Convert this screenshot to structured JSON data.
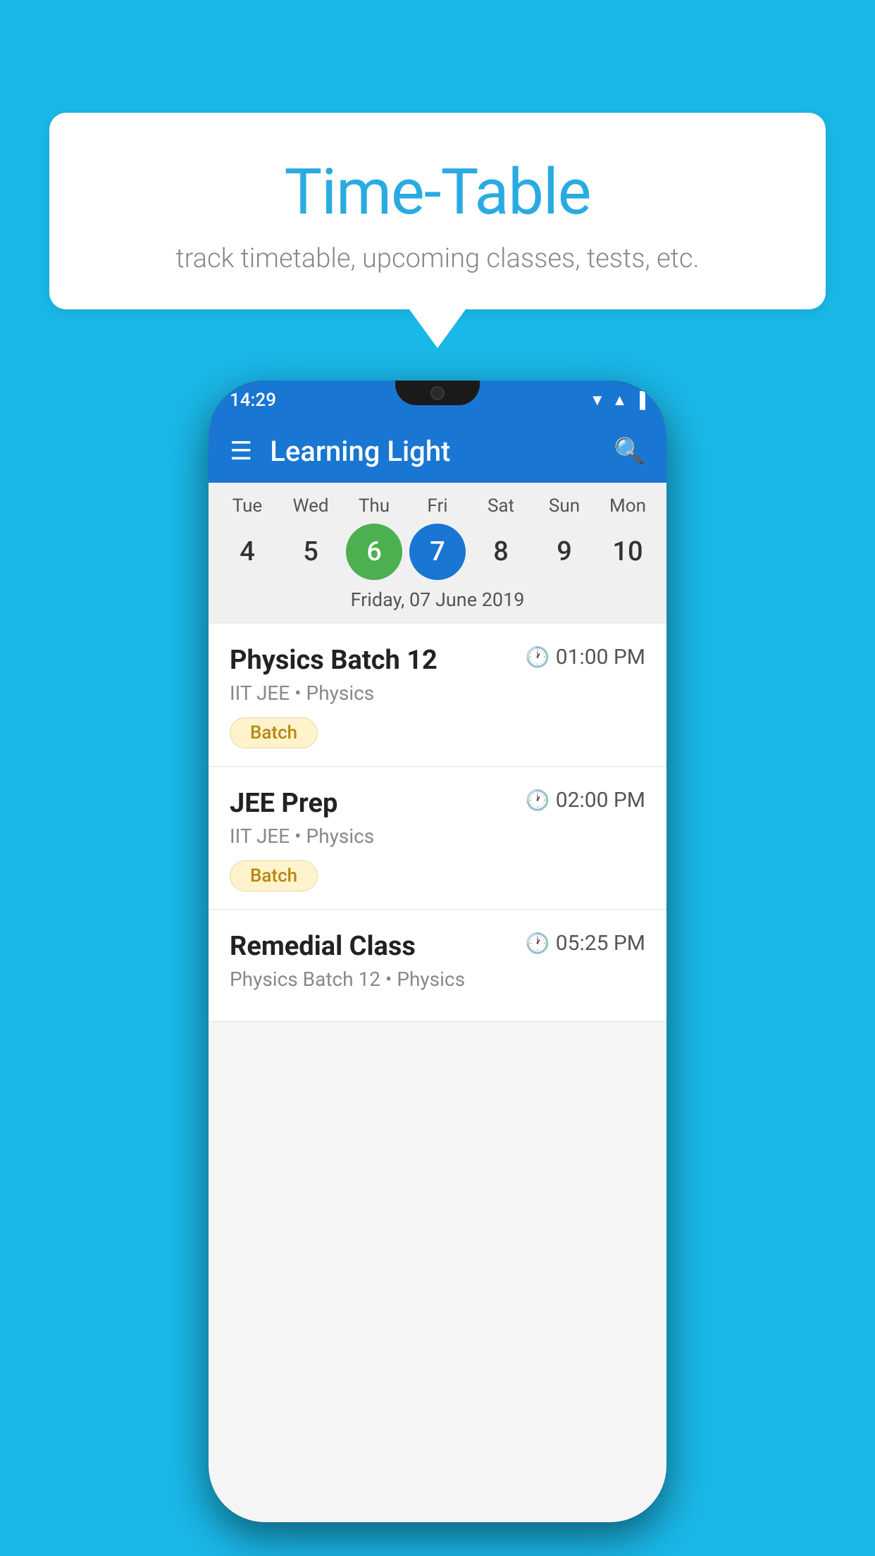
{
  "background_color": "#1ab8e8",
  "speech_bubble": {
    "title": "Time-Table",
    "subtitle": "track timetable, upcoming classes, tests, etc."
  },
  "phone": {
    "status_bar": {
      "time": "14:29",
      "icons": [
        "wifi",
        "signal",
        "battery"
      ]
    },
    "app_header": {
      "title": "Learning Light"
    },
    "calendar": {
      "days": [
        {
          "label": "Tue",
          "num": "4"
        },
        {
          "label": "Wed",
          "num": "5"
        },
        {
          "label": "Thu",
          "num": "6",
          "state": "today"
        },
        {
          "label": "Fri",
          "num": "7",
          "state": "selected"
        },
        {
          "label": "Sat",
          "num": "8"
        },
        {
          "label": "Sun",
          "num": "9"
        },
        {
          "label": "Mon",
          "num": "10"
        }
      ],
      "selected_date_label": "Friday, 07 June 2019"
    },
    "classes": [
      {
        "name": "Physics Batch 12",
        "time": "01:00 PM",
        "subtitle": "IIT JEE • Physics",
        "badge": "Batch"
      },
      {
        "name": "JEE Prep",
        "time": "02:00 PM",
        "subtitle": "IIT JEE • Physics",
        "badge": "Batch"
      },
      {
        "name": "Remedial Class",
        "time": "05:25 PM",
        "subtitle": "Physics Batch 12 • Physics",
        "badge": null
      }
    ]
  }
}
